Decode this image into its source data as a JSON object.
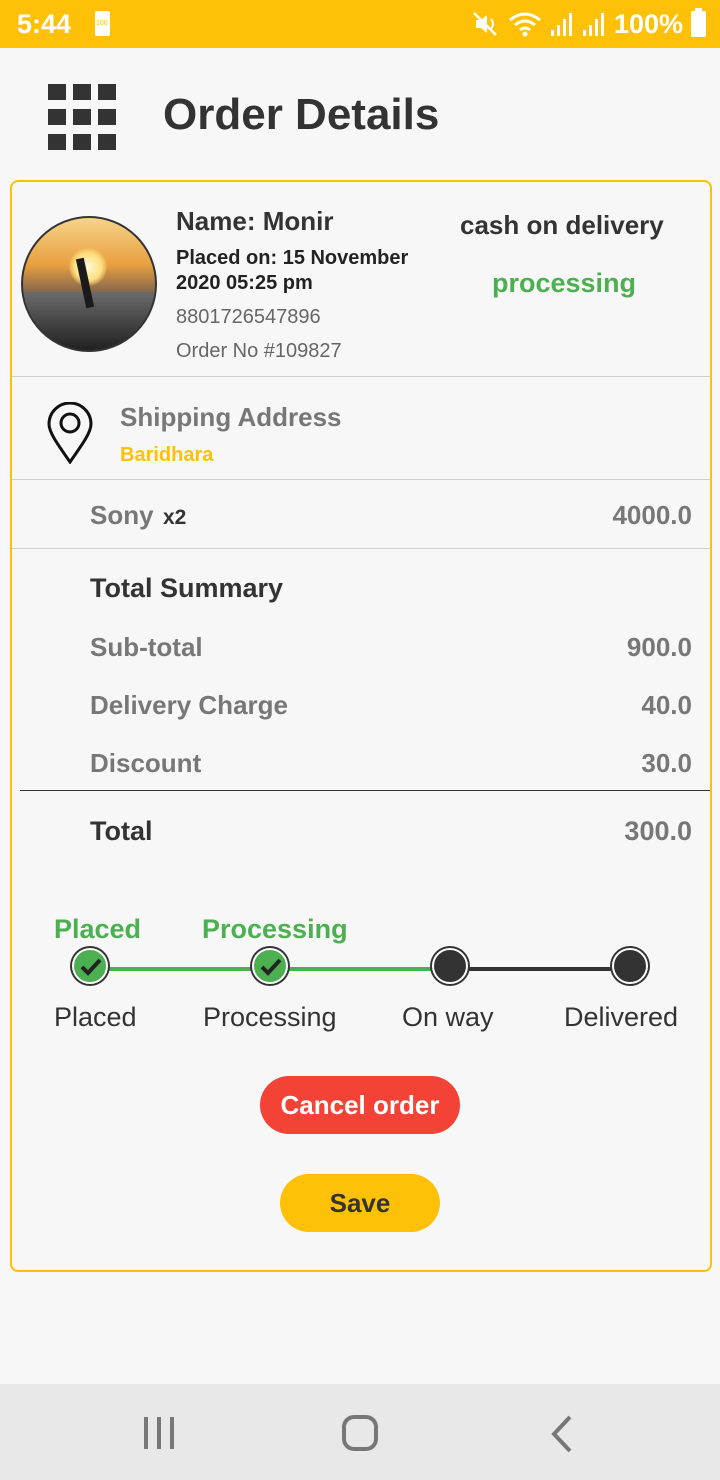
{
  "status_bar": {
    "time": "5:44",
    "battery_small": "100",
    "battery_percent": "100%"
  },
  "header": {
    "title": "Order Details",
    "menu_icon": "grid-menu-icon"
  },
  "order": {
    "customer_name": "Name: Monir",
    "placed_on": "Placed on: 15 November 2020 05:25 pm",
    "phone": "8801726547896",
    "order_no": "Order No #109827",
    "payment_method": "cash on delivery",
    "status": "processing"
  },
  "shipping": {
    "title": "Shipping Address",
    "address": "Baridhara"
  },
  "items": [
    {
      "name": "Sony",
      "qty": "x2",
      "price": "4000.0"
    }
  ],
  "summary": {
    "title": "Total Summary",
    "rows": [
      {
        "label": "Sub-total",
        "value": "900.0"
      },
      {
        "label": "Delivery Charge",
        "value": "40.0"
      },
      {
        "label": "Discount",
        "value": "30.0"
      }
    ],
    "total_label": "Total",
    "total_value": "300.0"
  },
  "tracker": {
    "steps": [
      {
        "top_label": "Placed",
        "label": "Placed",
        "done": true
      },
      {
        "top_label": "Processing",
        "label": "Processing",
        "done": true
      },
      {
        "top_label": "",
        "label": "On way",
        "done": false
      },
      {
        "top_label": "",
        "label": "Delivered",
        "done": false
      }
    ]
  },
  "actions": {
    "cancel_label": "Cancel order",
    "save_label": "Save"
  },
  "colors": {
    "accent": "#ffc107",
    "success": "#4caf50",
    "danger": "#f44336",
    "text": "#333333"
  }
}
